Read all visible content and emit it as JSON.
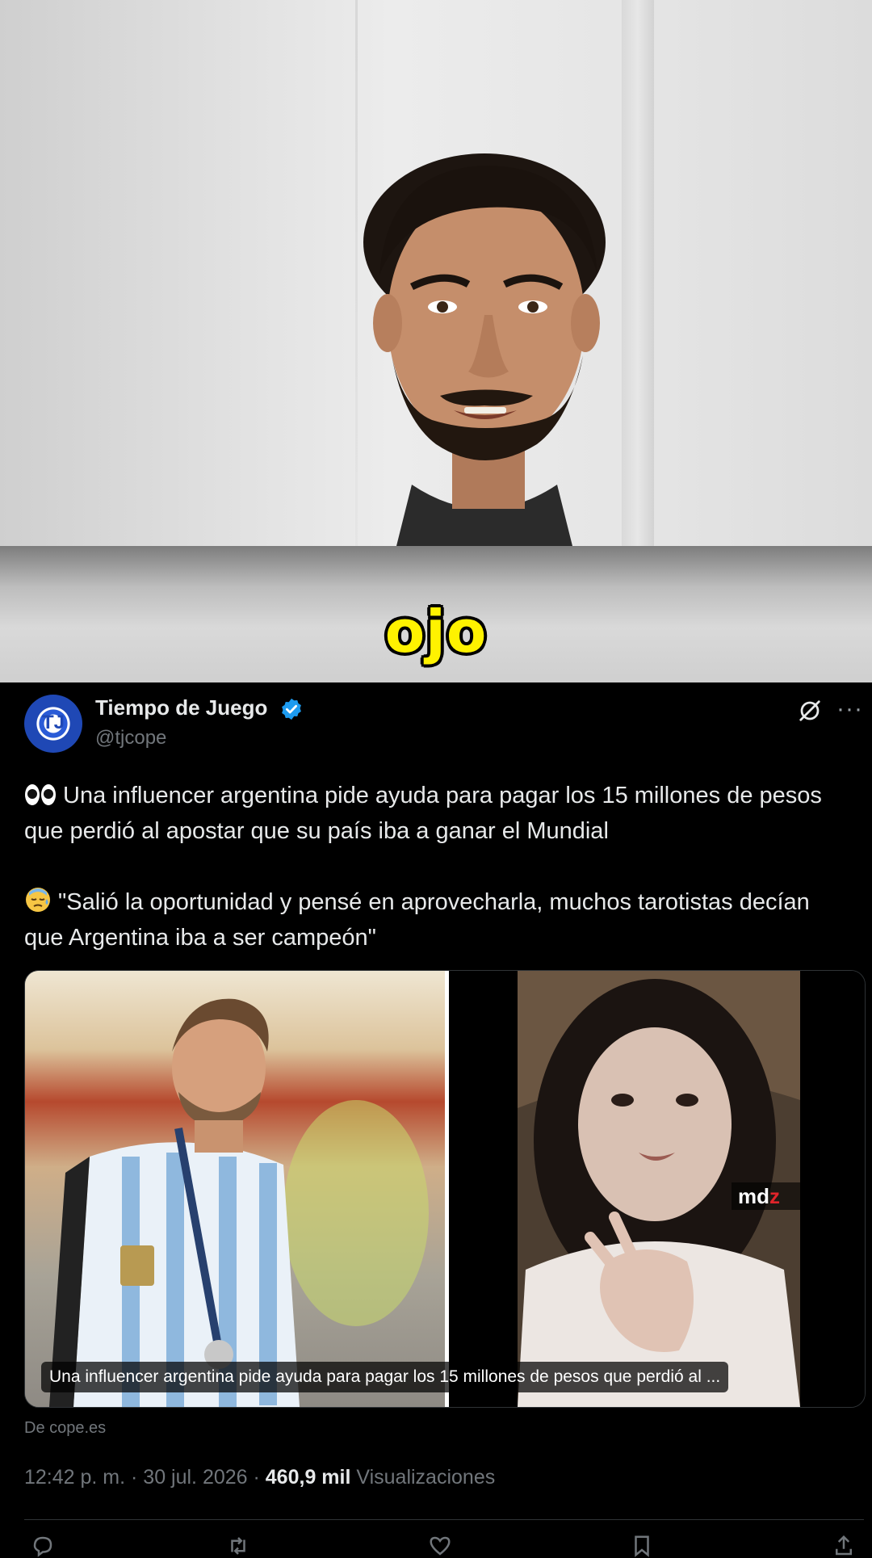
{
  "video": {
    "caption": "ojo"
  },
  "tweet": {
    "author_name": "Tiempo de Juego",
    "author_handle": "@tjcope",
    "paragraph1": "Una influencer argentina pide ayuda para pagar los 15 millones de pesos que perdió al apostar que su país iba a ganar el Mundial",
    "paragraph2": "\"Salió la oportunidad y pensé en aprovecharla, muchos tarotistas decían que Argentina iba a ser campeón\"",
    "media_caption": "Una influencer argentina pide ayuda para pagar los 15 millones de pesos que perdió al ...",
    "media_watermark_main": "md",
    "media_watermark_accent": "z",
    "source": "De cope.es",
    "timestamp": "12:42 p. m. · 30 jul. 2026 · ",
    "views_count": "460,9 mil",
    "views_label": " Visualizaciones",
    "icons": {
      "paragraph1_emoji": "eyes-emoji-icon",
      "paragraph2_emoji": "downcast-sweat-emoji-icon",
      "verified": "verified-badge-icon",
      "grok": "grok-icon",
      "more": "more-icon"
    },
    "colors": {
      "verified": "#1d9bf0",
      "background": "#000000",
      "secondary_text": "#71767b",
      "caption": "#fff200"
    }
  }
}
